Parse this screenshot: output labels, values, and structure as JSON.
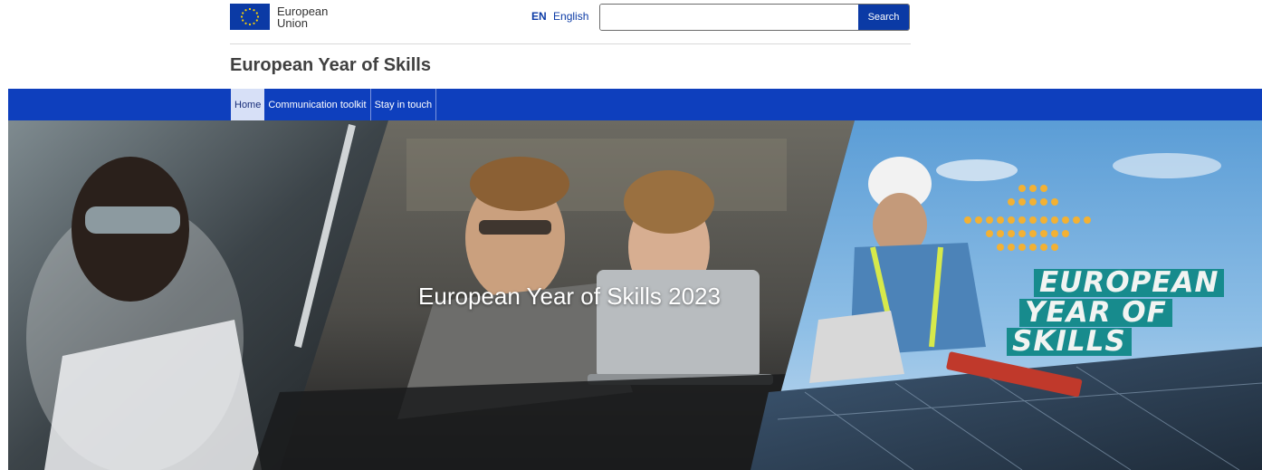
{
  "header": {
    "logo_line1": "European",
    "logo_line2": "Union",
    "lang_code": "EN",
    "lang_name": "English",
    "search_placeholder": "",
    "search_button": "Search",
    "site_title": "European Year of Skills"
  },
  "nav": {
    "items": [
      {
        "label": "Home",
        "active": true
      },
      {
        "label": "Communication toolkit",
        "active": false
      },
      {
        "label": "Stay in touch",
        "active": false
      }
    ]
  },
  "hero": {
    "title": "European Year of Skills 2023",
    "badge_line1": "EUROPEAN",
    "badge_line2": "YEAR OF",
    "badge_line3": "SKILLS"
  },
  "colors": {
    "nav_bg": "#0e3fbd",
    "eu_flag": "#0b3aa5",
    "badge_teal": "#178b8d",
    "badge_gold": "#f2b134"
  },
  "icons": {
    "flag": "eu-flag-icon"
  }
}
